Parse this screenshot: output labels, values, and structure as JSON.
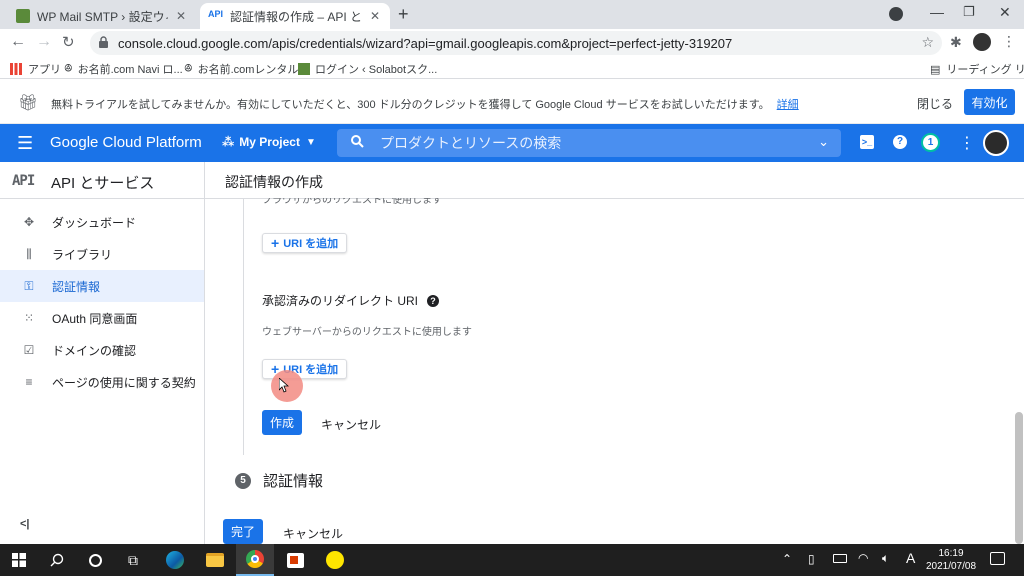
{
  "browser": {
    "tabs": [
      {
        "title": "WP Mail SMTP › 設定ウィザード",
        "active": false
      },
      {
        "title": "認証情報の作成 – API とサービス – ",
        "active": true
      }
    ],
    "url": "console.cloud.google.com/apis/credentials/wizard?api=gmail.googleapis.com&project=perfect-jetty-319207",
    "bookmarks": [
      "アプリ",
      "お名前.com Navi ロ...",
      "お名前.comレンタル...",
      "ログイン ‹ Solabotスク..."
    ],
    "reading_list": "リーディング リスト"
  },
  "banner": {
    "text": "無料トライアルを試してみませんか。有効にしていただくと、300 ドル分のクレジットを獲得して Google Cloud サービスをお試しいただけます。",
    "details_link": "詳細",
    "close": "閉じる",
    "activate": "有効化"
  },
  "header": {
    "product": "Google Cloud Platform",
    "project": "My Project",
    "search_placeholder": "プロダクトとリソースの検索",
    "notification_count": "1"
  },
  "sidenav": {
    "title_icon": "API",
    "title": "API とサービス",
    "items": [
      {
        "label": "ダッシュボード",
        "icon": "dashboard-icon",
        "glyph": "✥"
      },
      {
        "label": "ライブラリ",
        "icon": "library-icon",
        "glyph": "⫼"
      },
      {
        "label": "認証情報",
        "icon": "key-icon",
        "glyph": "⚿"
      },
      {
        "label": "OAuth 同意画面",
        "icon": "consent-icon",
        "glyph": "⁙"
      },
      {
        "label": "ドメインの確認",
        "icon": "checkbox-icon",
        "glyph": "☑"
      },
      {
        "label": "ページの使用に関する契約",
        "icon": "settings-list-icon",
        "glyph": "≡"
      }
    ],
    "collapse": "<|"
  },
  "main": {
    "page_title": "認証情報の作成",
    "origins_hint": "ブラウザからのリクエストに使用します",
    "add_uri_1": "URI を追加",
    "redirect_title": "承認済みのリダイレクト URI",
    "redirect_hint": "ウェブサーバーからのリクエストに使用します",
    "add_uri_2": "URI を追加",
    "create": "作成",
    "cancel": "キャンセル",
    "step_number": "5",
    "step_title": "認証情報",
    "done": "完了",
    "cancel2": "キャンセル"
  },
  "taskbar": {
    "time": "16:19",
    "date": "2021/07/08",
    "ime": "A"
  },
  "colors": {
    "brand": "#1a73e8",
    "taskbar": "#1f1f1f",
    "cursor_ring": "#f28b82"
  }
}
